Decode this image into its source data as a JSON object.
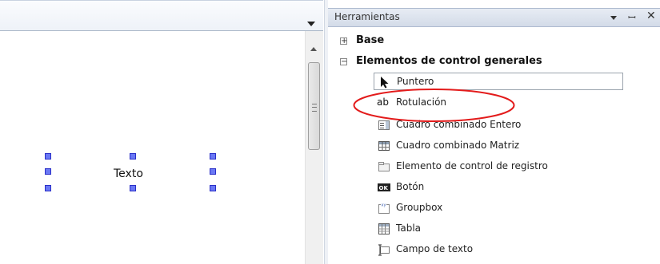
{
  "designer": {
    "label_text": "Texto"
  },
  "toolbox": {
    "title": "Herramientas",
    "groups": [
      {
        "label": "Base",
        "toggle": "+",
        "expanded": false
      },
      {
        "label": "Elementos de control generales",
        "toggle": "−",
        "expanded": true
      }
    ],
    "items": [
      {
        "label": "Puntero",
        "icon": "pointer-icon"
      },
      {
        "label": "Rotulación",
        "icon": "ab-label-icon"
      },
      {
        "label": "Cuadro combinado Entero",
        "icon": "combobox-integer-icon"
      },
      {
        "label": "Cuadro combinado Matriz",
        "icon": "combobox-matrix-icon"
      },
      {
        "label": "Elemento de control de registro",
        "icon": "register-control-icon"
      },
      {
        "label": "Botón",
        "icon": "ok-button-icon"
      },
      {
        "label": "Groupbox",
        "icon": "groupbox-icon"
      },
      {
        "label": "Tabla",
        "icon": "table-icon"
      },
      {
        "label": "Campo de texto",
        "icon": "text-field-icon"
      }
    ]
  },
  "icons": {
    "pin": "pin-icon",
    "close": "close-icon",
    "menu": "dropdown-arrow-icon"
  },
  "colors": {
    "selection_handle": "#6a78f4",
    "highlight": "#e31b1b",
    "panel_header": "#dce3ee"
  }
}
